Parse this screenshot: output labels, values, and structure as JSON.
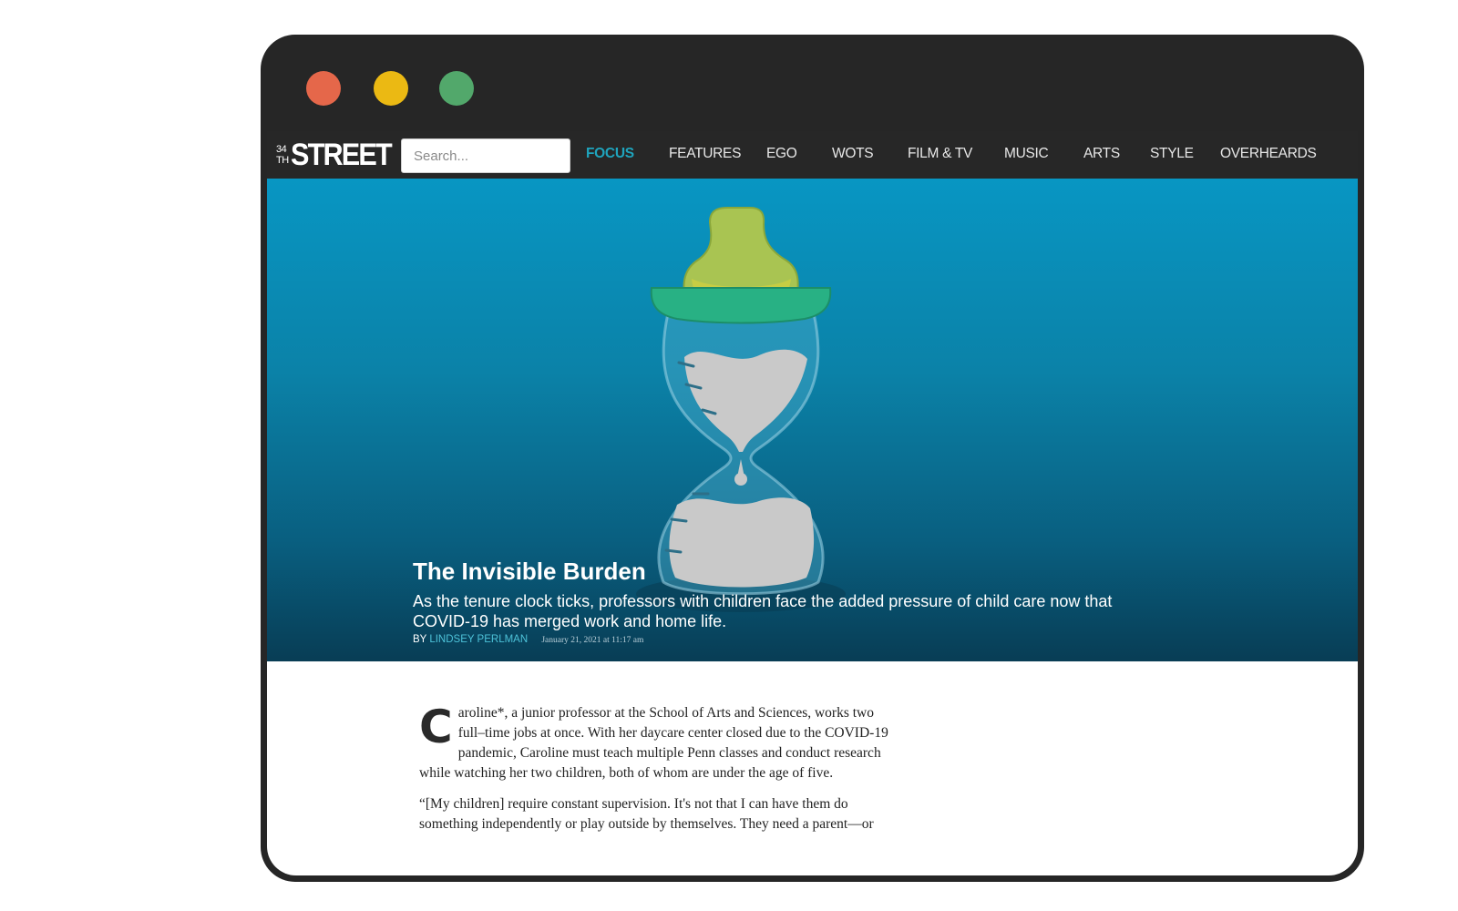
{
  "window": {
    "controls": {
      "close_color": "#e5674a",
      "minimize_color": "#ebb913",
      "maximize_color": "#52a86b"
    }
  },
  "site": {
    "logo_number_top": "34",
    "logo_number_bottom": "TH",
    "logo_word": "STREET"
  },
  "search": {
    "placeholder": "Search..."
  },
  "nav": {
    "items": [
      {
        "label": "FOCUS",
        "active": true
      },
      {
        "label": "FEATURES"
      },
      {
        "label": "EGO"
      },
      {
        "label": "WOTS"
      },
      {
        "label": "FILM & TV"
      },
      {
        "label": "MUSIC"
      },
      {
        "label": "ARTS"
      },
      {
        "label": "STYLE"
      },
      {
        "label": "OVERHEARDS"
      }
    ]
  },
  "hero": {
    "illustration": "hourglass-bottle-illustration",
    "title": "The Invisible Burden",
    "dek": "As the tenure clock ticks, professors with children face the added pressure of child care now that COVID-19 has merged work and home life.",
    "byline_prefix": "BY",
    "author": "LINDSEY PERLMAN",
    "date": "January 21, 2021 at 11:17 am"
  },
  "article": {
    "dropcap": "C",
    "paragraph1": "aroline*, a junior professor at the School of Arts and Sciences, works two full–time jobs at once. With her daycare center closed due to the COVID-19 pandemic, Caroline must teach multiple Penn classes and conduct research while watching her two children, both of whom are under the age of five.",
    "paragraph2": "“[My children] require constant supervision. It's not that I can have them do something independently or play outside by themselves. They need a parent—or"
  },
  "colors": {
    "accent": "#1fa4bd",
    "frame": "#262626",
    "hero_top": "#0896c3",
    "hero_bottom": "#083d55"
  }
}
